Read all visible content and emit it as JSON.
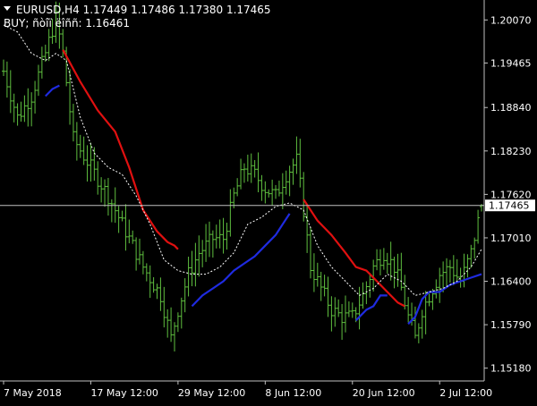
{
  "header": {
    "symbol_line": "EURUSD,H4  1.17449 1.17486 1.17380 1.17465",
    "indicator_line": "BUY; ñòîï ëîññ: 1.16461",
    "menu_icon": "triangle-down-icon"
  },
  "colors": {
    "background": "#000000",
    "bars": "#5fbf3f",
    "frame": "#c0c0c0",
    "current_price_line": "#c0c0c0",
    "price_tag_bg": "#ffffff",
    "price_tag_text": "#000000",
    "sell_stop_line": "#e01010",
    "buy_stop_line": "#1f2be0",
    "signal_line": "#ffffff",
    "axis_text": "#ffffff"
  },
  "chart_data": {
    "type": "ohlc",
    "symbol": "EURUSD",
    "timeframe": "H4",
    "title": "EURUSD,H4",
    "ylim": [
      1.15,
      1.2035
    ],
    "y_ticks": [
      1.2007,
      1.19465,
      1.1884,
      1.1823,
      1.1762,
      1.1701,
      1.164,
      1.1579,
      1.1518
    ],
    "y_tick_labels": [
      "1.20070",
      "1.19465",
      "1.18840",
      "1.18230",
      "1.17620",
      "1.17010",
      "1.16400",
      "1.15790",
      "1.15180"
    ],
    "x_ticks": [
      {
        "label": "7 May 2018",
        "index": 0
      },
      {
        "label": "17 May 12:00",
        "index": 25
      },
      {
        "label": "29 May 12:00",
        "index": 50
      },
      {
        "label": "8 Jun 12:00",
        "index": 75
      },
      {
        "label": "20 Jun 12:00",
        "index": 100
      },
      {
        "label": "2 Jul 12:00",
        "index": 125
      }
    ],
    "bar_count": 138,
    "current_price": 1.17465,
    "current_price_label": "1.17465",
    "ohlc_last": {
      "open": 1.17449,
      "high": 1.17486,
      "low": 1.1738,
      "close": 1.17465
    },
    "close_anchors": [
      [
        0,
        1.1935
      ],
      [
        4,
        1.187
      ],
      [
        8,
        1.19
      ],
      [
        12,
        1.196
      ],
      [
        15,
        1.201
      ],
      [
        17,
        1.196
      ],
      [
        20,
        1.184
      ],
      [
        25,
        1.18
      ],
      [
        30,
        1.176
      ],
      [
        35,
        1.171
      ],
      [
        40,
        1.166
      ],
      [
        45,
        1.162
      ],
      [
        48,
        1.156
      ],
      [
        50,
        1.16
      ],
      [
        53,
        1.165
      ],
      [
        56,
        1.168
      ],
      [
        60,
        1.17
      ],
      [
        63,
        1.17
      ],
      [
        66,
        1.176
      ],
      [
        69,
        1.18
      ],
      [
        72,
        1.179
      ],
      [
        75,
        1.177
      ],
      [
        78,
        1.176
      ],
      [
        81,
        1.179
      ],
      [
        84,
        1.181
      ],
      [
        86,
        1.174
      ],
      [
        88,
        1.166
      ],
      [
        91,
        1.163
      ],
      [
        94,
        1.16
      ],
      [
        97,
        1.159
      ],
      [
        100,
        1.159
      ],
      [
        103,
        1.162
      ],
      [
        106,
        1.166
      ],
      [
        109,
        1.168
      ],
      [
        112,
        1.166
      ],
      [
        114,
        1.163
      ],
      [
        116,
        1.159
      ],
      [
        118,
        1.156
      ],
      [
        120,
        1.16
      ],
      [
        122,
        1.162
      ],
      [
        125,
        1.165
      ],
      [
        128,
        1.166
      ],
      [
        131,
        1.164
      ],
      [
        134,
        1.168
      ],
      [
        137,
        1.17465
      ]
    ],
    "series": [
      {
        "name": "sell_stop_1",
        "color": "#e01010",
        "points": [
          [
            17,
            1.1965
          ],
          [
            22,
            1.192
          ],
          [
            27,
            1.188
          ],
          [
            32,
            1.185
          ],
          [
            36,
            1.18
          ],
          [
            40,
            1.174
          ],
          [
            44,
            1.171
          ],
          [
            47,
            1.1695
          ],
          [
            49,
            1.169
          ],
          [
            50,
            1.1685
          ]
        ]
      },
      {
        "name": "sell_stop_2",
        "color": "#e01010",
        "points": [
          [
            86,
            1.1755
          ],
          [
            90,
            1.1725
          ],
          [
            94,
            1.1705
          ],
          [
            98,
            1.168
          ],
          [
            101,
            1.166
          ],
          [
            104,
            1.1655
          ],
          [
            107,
            1.164
          ],
          [
            110,
            1.1625
          ],
          [
            113,
            1.161
          ],
          [
            115,
            1.1605
          ]
        ]
      },
      {
        "name": "buy_stop_1",
        "color": "#1f2be0",
        "points": [
          [
            12,
            1.19
          ],
          [
            14,
            1.191
          ],
          [
            16,
            1.1915
          ]
        ]
      },
      {
        "name": "buy_stop_2",
        "color": "#1f2be0",
        "points": [
          [
            54,
            1.1605
          ],
          [
            57,
            1.162
          ],
          [
            60,
            1.163
          ],
          [
            63,
            1.164
          ],
          [
            66,
            1.1655
          ],
          [
            69,
            1.1665
          ],
          [
            72,
            1.1675
          ],
          [
            75,
            1.169
          ],
          [
            78,
            1.1705
          ],
          [
            80,
            1.172
          ],
          [
            82,
            1.1735
          ]
        ]
      },
      {
        "name": "buy_stop_3",
        "color": "#1f2be0",
        "points": [
          [
            101,
            1.1585
          ],
          [
            104,
            1.16
          ],
          [
            106,
            1.1605
          ],
          [
            108,
            1.162
          ],
          [
            110,
            1.162
          ]
        ]
      },
      {
        "name": "buy_stop_4",
        "color": "#1f2be0",
        "points": [
          [
            116,
            1.158
          ],
          [
            118,
            1.159
          ],
          [
            120,
            1.1615
          ],
          [
            122,
            1.1625
          ],
          [
            125,
            1.1625
          ],
          [
            128,
            1.1635
          ],
          [
            131,
            1.164
          ],
          [
            134,
            1.1645
          ],
          [
            137,
            1.165
          ]
        ]
      },
      {
        "name": "signal",
        "color": "#ffffff",
        "dashed": true,
        "points": [
          [
            0,
            1.2
          ],
          [
            4,
            1.199
          ],
          [
            8,
            1.196
          ],
          [
            12,
            1.195
          ],
          [
            15,
            1.196
          ],
          [
            18,
            1.195
          ],
          [
            22,
            1.187
          ],
          [
            26,
            1.182
          ],
          [
            30,
            1.18
          ],
          [
            34,
            1.179
          ],
          [
            38,
            1.176
          ],
          [
            42,
            1.172
          ],
          [
            46,
            1.167
          ],
          [
            50,
            1.1655
          ],
          [
            54,
            1.165
          ],
          [
            58,
            1.165
          ],
          [
            62,
            1.166
          ],
          [
            66,
            1.168
          ],
          [
            70,
            1.172
          ],
          [
            74,
            1.173
          ],
          [
            78,
            1.1745
          ],
          [
            82,
            1.175
          ],
          [
            86,
            1.174
          ],
          [
            90,
            1.169
          ],
          [
            94,
            1.166
          ],
          [
            98,
            1.164
          ],
          [
            102,
            1.162
          ],
          [
            106,
            1.163
          ],
          [
            110,
            1.165
          ],
          [
            114,
            1.164
          ],
          [
            118,
            1.162
          ],
          [
            122,
            1.1625
          ],
          [
            126,
            1.163
          ],
          [
            130,
            1.164
          ],
          [
            134,
            1.166
          ],
          [
            137,
            1.1685
          ]
        ]
      }
    ]
  }
}
